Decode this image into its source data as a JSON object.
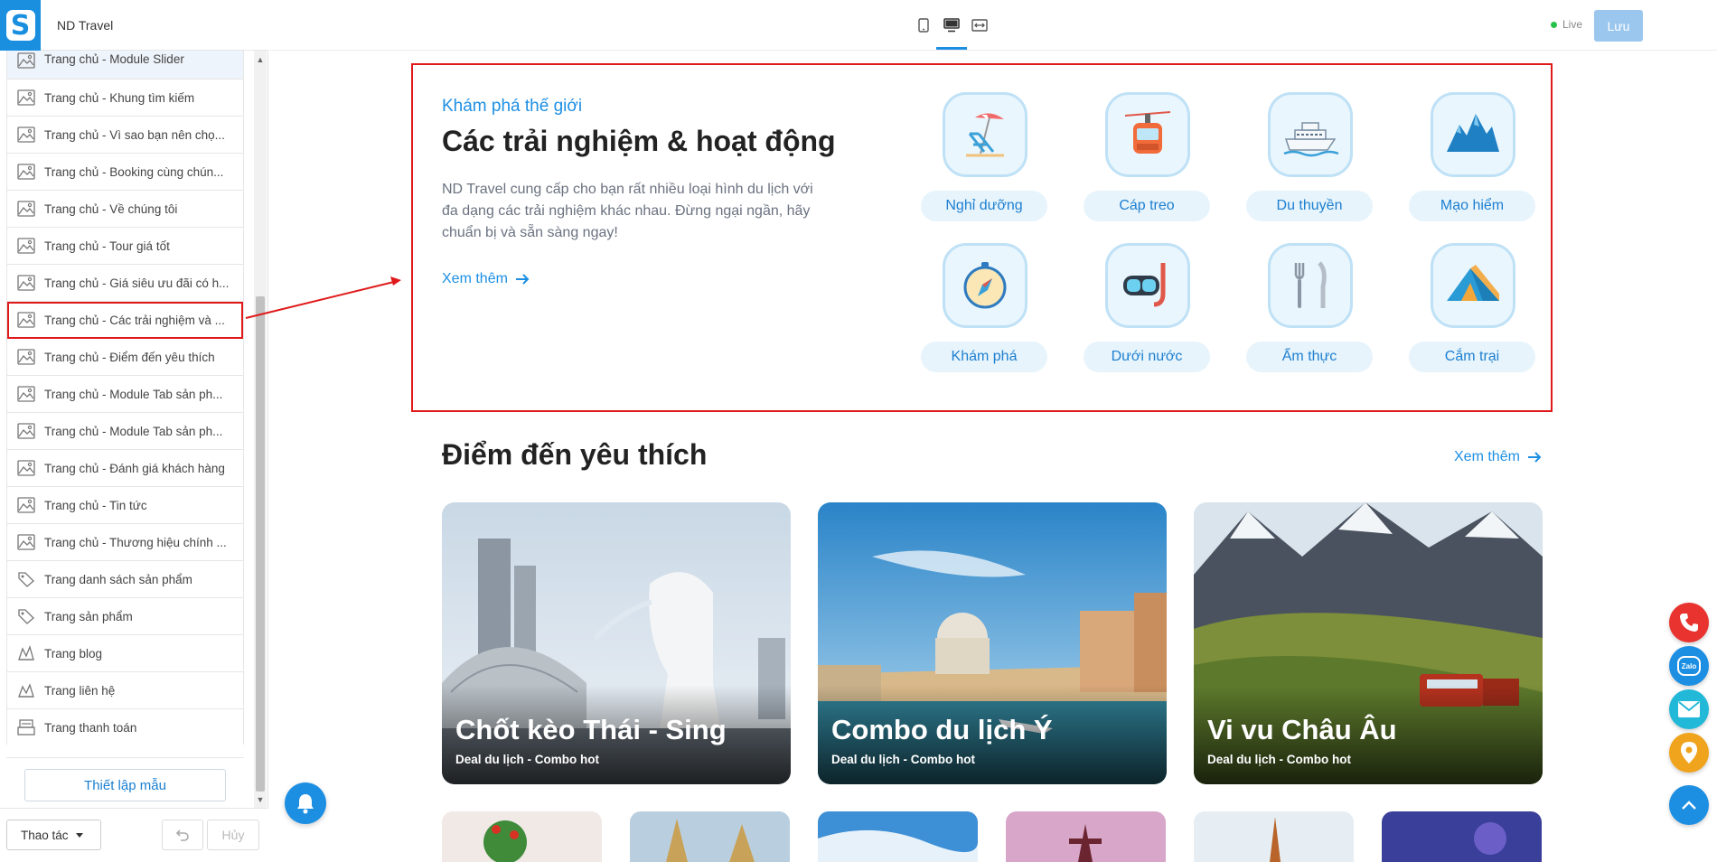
{
  "app": {
    "logo_letter": "S",
    "title": "ND Travel"
  },
  "sidebar": {
    "items": [
      {
        "label": "Trang chủ - Module Slider",
        "icon": "image-icon"
      },
      {
        "label": "Trang chủ - Khung tìm kiếm",
        "icon": "image-icon"
      },
      {
        "label": "Trang chủ - Vì sao bạn nên chọ...",
        "icon": "image-icon"
      },
      {
        "label": "Trang chủ - Booking cùng chún...",
        "icon": "image-icon"
      },
      {
        "label": "Trang chủ - Về chúng tôi",
        "icon": "image-icon"
      },
      {
        "label": "Trang chủ - Tour giá tốt",
        "icon": "image-icon"
      },
      {
        "label": "Trang chủ - Giá siêu ưu đãi có h...",
        "icon": "image-icon"
      },
      {
        "label": "Trang chủ - Các trải nghiệm và ...",
        "icon": "image-icon",
        "selected": true
      },
      {
        "label": "Trang chủ - Điểm đến yêu thích",
        "icon": "image-icon"
      },
      {
        "label": "Trang chủ - Module Tab sản ph...",
        "icon": "image-icon"
      },
      {
        "label": "Trang chủ - Module Tab sản ph...",
        "icon": "image-icon"
      },
      {
        "label": "Trang chủ - Đánh giá khách hàng",
        "icon": "image-icon"
      },
      {
        "label": "Trang chủ - Tin tức",
        "icon": "image-icon"
      },
      {
        "label": "Trang chủ - Thương hiệu chính ...",
        "icon": "image-icon"
      },
      {
        "label": "Trang danh sách sản phẩm",
        "icon": "tag-icon"
      },
      {
        "label": "Trang sản phẩm",
        "icon": "tag-icon"
      },
      {
        "label": "Trang blog",
        "icon": "blog-icon"
      },
      {
        "label": "Trang liên hệ",
        "icon": "contact-icon"
      },
      {
        "label": "Trang thanh toán",
        "icon": "payment-icon"
      }
    ],
    "template_button": "Thiết lập mẫu",
    "actions_button": "Thao tác",
    "cancel_button": "Hủy"
  },
  "topbar": {
    "devices": [
      "mobile-icon",
      "desktop-icon",
      "fullwidth-icon"
    ],
    "active_device": "desktop-icon",
    "live_label": "Live",
    "save_label": "Lưu",
    "live_color": "#27c24c"
  },
  "experiences": {
    "kicker": "Khám phá thế giới",
    "title": "Các trải nghiệm & hoạt động",
    "description": "ND Travel cung cấp cho bạn rất nhiều loại hình du lịch với đa dạng các trải nghiệm khác nhau. Đừng ngại ngần, hãy chuẩn bị và sẵn sàng ngay!",
    "more_link": "Xem thêm",
    "categories": [
      {
        "label": "Nghỉ dưỡng",
        "icon": "beach-chair-icon"
      },
      {
        "label": "Cáp treo",
        "icon": "cable-car-icon"
      },
      {
        "label": "Du thuyền",
        "icon": "cruise-ship-icon"
      },
      {
        "label": "Mạo hiểm",
        "icon": "mountain-icon"
      },
      {
        "label": "Khám phá",
        "icon": "compass-icon"
      },
      {
        "label": "Dưới nước",
        "icon": "diving-mask-icon"
      },
      {
        "label": "Ẩm thực",
        "icon": "cutlery-icon"
      },
      {
        "label": "Cắm trại",
        "icon": "tent-icon"
      }
    ]
  },
  "favorites": {
    "title": "Điểm đến yêu thích",
    "more_link": "Xem thêm",
    "cards": [
      {
        "name": "Chốt kèo Thái - Sing",
        "subtitle": "Deal du lịch - Combo hot"
      },
      {
        "name": "Combo du lịch Ý",
        "subtitle": "Deal du lịch - Combo hot"
      },
      {
        "name": "Vi vu Châu Âu",
        "subtitle": "Deal du lịch - Combo hot"
      }
    ]
  },
  "floating_buttons": [
    "phone-icon",
    "zalo-icon",
    "mail-icon",
    "location-icon",
    "scroll-top-icon"
  ],
  "floating_text": {
    "zalo": "Zalo"
  },
  "colors": {
    "accent": "#1d8fe3",
    "highlight": "#e01a1a"
  }
}
